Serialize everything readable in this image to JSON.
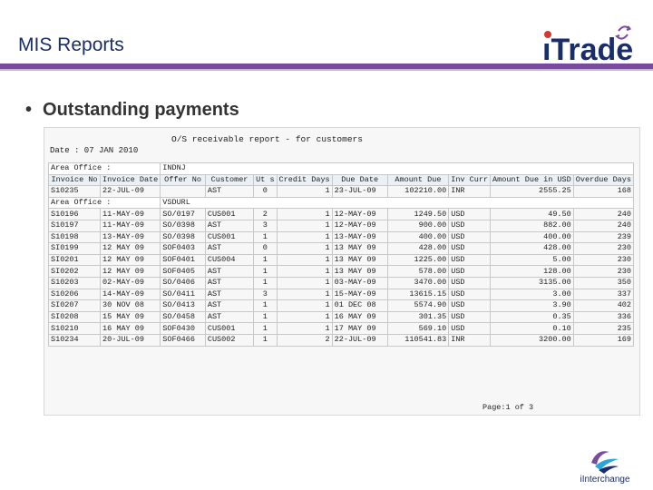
{
  "slide": {
    "title": "MIS Reports",
    "bullet": "Outstanding payments",
    "brand_name": "iTrade",
    "footer_brand": "iInterchange",
    "accent_color": "#7a4aa0",
    "title_color": "#1a2d6b"
  },
  "report": {
    "title": "O/S receivable report - for customers",
    "date_line": "Date : 07 JAN 2010",
    "area_label": "Area Office :",
    "area1": "INDNJ",
    "area2": "VSDURL",
    "headers": [
      "Invoice No",
      "Invoice Date",
      "Offer No",
      "Customer",
      "Ut s",
      "Credit Days",
      "Due Date",
      "Amount Due",
      "Inv Curr",
      "Amount Due in USD",
      "Overdue Days"
    ],
    "rows_area1": [
      [
        "S10235",
        "22-JUL-09",
        "",
        "AST",
        "0",
        "1",
        "23-JUL-09",
        "102210.00",
        "INR",
        "2555.25",
        "168"
      ]
    ],
    "rows_area2": [
      [
        "S10196",
        "11-MAY-09",
        "SO/0197",
        "CUS001",
        "2",
        "1",
        "12-MAY-09",
        "1249.50",
        "USD",
        "49.50",
        "240"
      ],
      [
        "S10197",
        "11-MAY-09",
        "SO/0398",
        "AST",
        "3",
        "1",
        "12-MAY-09",
        "900.00",
        "USD",
        "882.00",
        "240"
      ],
      [
        "S10198",
        "13-MAY-09",
        "SO/0398",
        "CUS001",
        "1",
        "1",
        "13-MAY-09",
        "400.00",
        "USD",
        "400.00",
        "239"
      ],
      [
        "SI0199",
        "12 MAY 09",
        "SOF0403",
        "AST",
        "0",
        "1",
        "13 MAY 09",
        "428.00",
        "USD",
        "428.00",
        "230"
      ],
      [
        "SI0201",
        "12 MAY 09",
        "SOF0401",
        "CUS004",
        "1",
        "1",
        "13 MAY 09",
        "1225.00",
        "USD",
        "5.00",
        "230"
      ],
      [
        "SI0202",
        "12 MAY 09",
        "SOF0405",
        "AST",
        "1",
        "1",
        "13 MAY 09",
        "578.00",
        "USD",
        "128.00",
        "230"
      ],
      [
        "S10203",
        "02-MAY-09",
        "SO/0406",
        "AST",
        "1",
        "1",
        "03-MAY-09",
        "3470.00",
        "USD",
        "3135.00",
        "350"
      ],
      [
        "S10206",
        "14-MAY-09",
        "SO/0411",
        "AST",
        "3",
        "1",
        "15-MAY-09",
        "13615.15",
        "USD",
        "3.00",
        "337"
      ],
      [
        "SI0207",
        "30 NOV 08",
        "SO/0413",
        "AST",
        "1",
        "1",
        "01 DEC 08",
        "5574.90",
        "USD",
        "3.90",
        "402"
      ],
      [
        "SI0208",
        "15 MAY 09",
        "SO/0458",
        "AST",
        "1",
        "1",
        "16 MAY 09",
        "301.35",
        "USD",
        "0.35",
        "336"
      ],
      [
        "S10210",
        "16 MAY 09",
        "SOF0430",
        "CUS001",
        "1",
        "1",
        "17 MAY 09",
        "569.10",
        "USD",
        "0.10",
        "235"
      ],
      [
        "S10234",
        "20-JUL-09",
        "SOF0466",
        "CUS002",
        "1",
        "2",
        "22-JUL-09",
        "110541.83",
        "INR",
        "3200.00",
        "169"
      ]
    ],
    "page_footer": "Page:1 of 3"
  }
}
